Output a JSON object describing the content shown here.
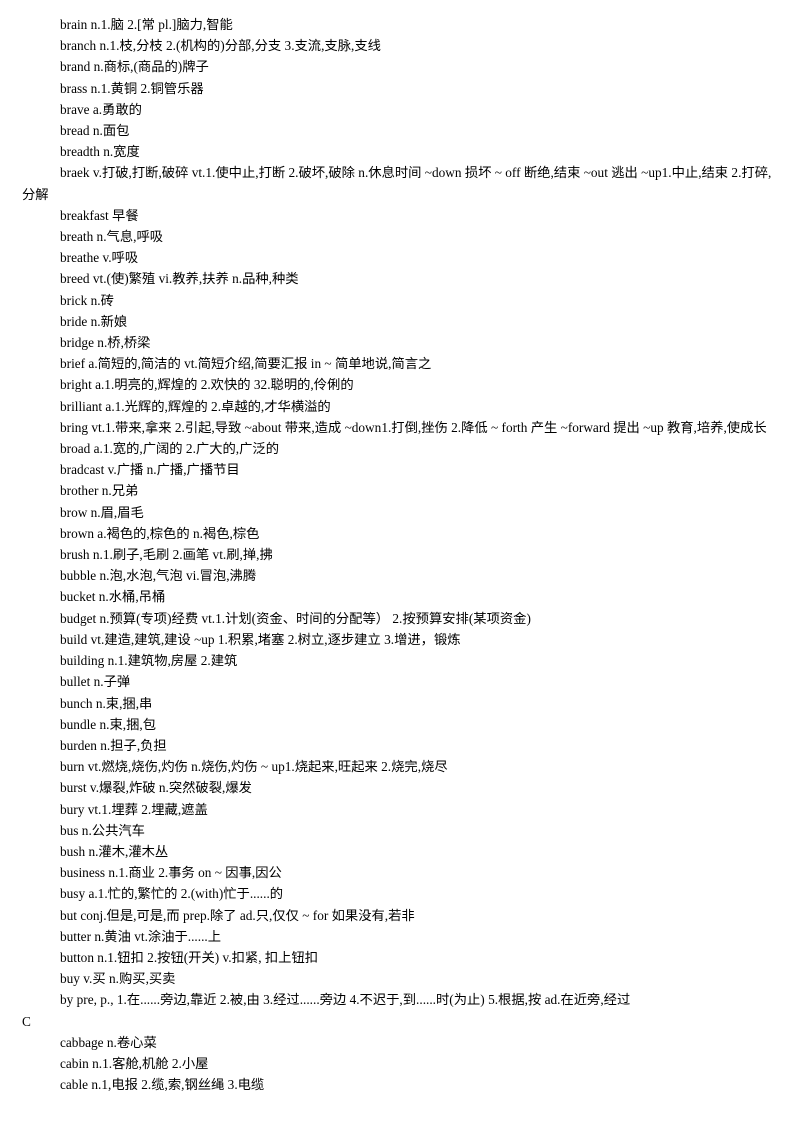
{
  "document": {
    "type": "bilingual-vocabulary-list",
    "page_background": "#ffffff",
    "text_color": "#000000",
    "blocks": [
      {
        "kind": "entry",
        "text": "brain n.1.脑  2.[常 pl.]脑力,智能"
      },
      {
        "kind": "entry",
        "text": "branch n.1.枝,分枝  2.(机构的)分部,分支  3.支流,支脉,支线"
      },
      {
        "kind": "entry",
        "text": "brand n.商标,(商品的)牌子"
      },
      {
        "kind": "entry",
        "text": "brass n.1.黄铜  2.铜管乐器"
      },
      {
        "kind": "entry",
        "text": "brave a.勇敢的"
      },
      {
        "kind": "entry",
        "text": "bread n.面包"
      },
      {
        "kind": "entry",
        "text": "breadth n.宽度"
      },
      {
        "kind": "entry",
        "text": "braek v.打破,打断,破碎  vt.1.使中止,打断  2.破坏,破除  n.休息时间  ~down 损坏  ~ off 断绝,结束  ~out 逃出  ~up1.中止,结束  2.打碎,分解"
      },
      {
        "kind": "entry",
        "text": "breakfast  早餐"
      },
      {
        "kind": "entry",
        "text": "breath n.气息,呼吸"
      },
      {
        "kind": "entry",
        "text": "breathe v.呼吸"
      },
      {
        "kind": "entry",
        "text": "breed vt.(使)繁殖  vi.教养,扶养  n.品种,种类"
      },
      {
        "kind": "entry",
        "text": "brick n.砖"
      },
      {
        "kind": "entry",
        "text": "bride n.新娘"
      },
      {
        "kind": "entry",
        "text": "bridge n.桥,桥梁"
      },
      {
        "kind": "entry",
        "text": "brief a.简短的,简洁的  vt.简短介绍,简要汇报  in ~  简单地说,简言之"
      },
      {
        "kind": "entry",
        "text": "bright a.1.明亮的,辉煌的  2.欢快的  32.聪明的,伶俐的"
      },
      {
        "kind": "entry",
        "text": "brilliant a.1.光辉的,辉煌的  2.卓越的,才华横溢的"
      },
      {
        "kind": "entry",
        "text": "bring vt.1.带来,拿来  2.引起,导致  ~about 带来,造成  ~down1.打倒,挫伤  2.降低  ~ forth 产生  ~forward 提出  ~up 教育,培养,使成长"
      },
      {
        "kind": "entry",
        "text": "broad a.1.宽的,广阔的  2.广大的,广泛的"
      },
      {
        "kind": "entry",
        "text": "bradcast v.广播  n.广播,广播节目"
      },
      {
        "kind": "entry",
        "text": "brother n.兄弟"
      },
      {
        "kind": "entry",
        "text": "brow n.眉,眉毛"
      },
      {
        "kind": "entry",
        "text": "brown a.褐色的,棕色的  n.褐色,棕色"
      },
      {
        "kind": "entry",
        "text": "brush n.1.刷子,毛刷  2.画笔  vt.刷,掸,拂"
      },
      {
        "kind": "entry",
        "text": "bubble n.泡,水泡,气泡  vi.冒泡,沸腾"
      },
      {
        "kind": "entry",
        "text": "bucket n.水桶,吊桶"
      },
      {
        "kind": "entry",
        "text": "budget n.预算(专项)经费  vt.1.计划(资金、时间的分配等）  2.按预算安排(某项资金)"
      },
      {
        "kind": "entry",
        "text": "build vt.建造,建筑,建设  ~up 1.积累,堵塞  2.树立,逐步建立  3.增进，锻炼"
      },
      {
        "kind": "entry",
        "text": "building n.1.建筑物,房屋  2.建筑"
      },
      {
        "kind": "entry",
        "text": "bullet n.子弹"
      },
      {
        "kind": "entry",
        "text": "bunch n.束,捆,串"
      },
      {
        "kind": "entry",
        "text": "bundle n.束,捆,包"
      },
      {
        "kind": "entry",
        "text": "burden n.担子,负担"
      },
      {
        "kind": "entry",
        "text": "burn vt.燃烧,烧伤,灼伤  n.烧伤,灼伤  ~ up1.烧起来,旺起来  2.烧完,烧尽"
      },
      {
        "kind": "entry",
        "text": "burst v.爆裂,炸破  n.突然破裂,爆发"
      },
      {
        "kind": "entry",
        "text": "bury vt.1.埋葬  2.埋藏,遮盖"
      },
      {
        "kind": "entry",
        "text": "bus n.公共汽车"
      },
      {
        "kind": "entry",
        "text": "bush n.灌木,灌木丛"
      },
      {
        "kind": "entry",
        "text": "business n.1.商业  2.事务  on ~  因事,因公"
      },
      {
        "kind": "entry",
        "text": "busy a.1.忙的,繁忙的  2.(with)忙于......的"
      },
      {
        "kind": "entry",
        "text": "but conj.但是,可是,而  prep.除了  ad.只,仅仅  ~ for 如果没有,若非"
      },
      {
        "kind": "entry",
        "text": "butter n.黄油  vt.涂油于......上"
      },
      {
        "kind": "entry",
        "text": "button n.1.钮扣  2.按钮(开关) v.扣紧, 扣上钮扣"
      },
      {
        "kind": "entry",
        "text": "buy v.买  n.购买,买卖"
      },
      {
        "kind": "entry",
        "text": "by pre, p., 1.在......旁边,靠近  2.被,由  3.经过......旁边  4.不迟于,到......时(为止) 5.根据,按  ad.在近旁,经过"
      },
      {
        "kind": "section",
        "text": "C"
      },
      {
        "kind": "entry",
        "text": "cabbage n.卷心菜"
      },
      {
        "kind": "entry",
        "text": "cabin n.1.客舱,机舱  2.小屋"
      },
      {
        "kind": "entry",
        "text": "cable n.1,电报  2.缆,索,钢丝绳  3.电缆"
      }
    ]
  }
}
